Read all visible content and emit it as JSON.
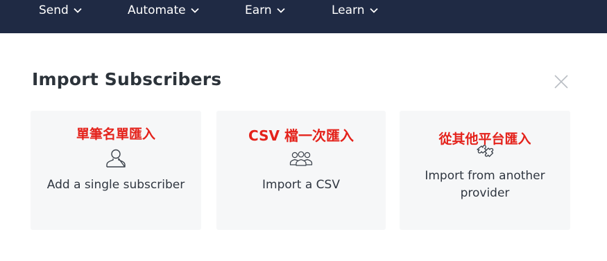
{
  "nav": {
    "items": [
      {
        "label": "Send",
        "icon": "chevron-down-icon"
      },
      {
        "label": "Automate",
        "icon": "chevron-down-icon"
      },
      {
        "label": "Earn",
        "icon": "chevron-down-icon"
      },
      {
        "label": "Learn",
        "icon": "chevron-down-icon"
      }
    ],
    "background": "#1f2a44"
  },
  "modal": {
    "title": "Import Subscribers",
    "close_icon": "close-icon",
    "options": [
      {
        "annotation": "單筆名單匯入",
        "label": "Add a single subscriber",
        "icon": "person-icon"
      },
      {
        "annotation": "CSV 檔一次匯入",
        "label": "Import a CSV",
        "icon": "group-icon"
      },
      {
        "annotation": "從其他平台匯入",
        "label": "Import from another provider",
        "icon": "puzzle-icon"
      }
    ]
  },
  "colors": {
    "annotation": "#e4221b",
    "card_background": "#f6f7f8",
    "text": "#2f3640"
  }
}
